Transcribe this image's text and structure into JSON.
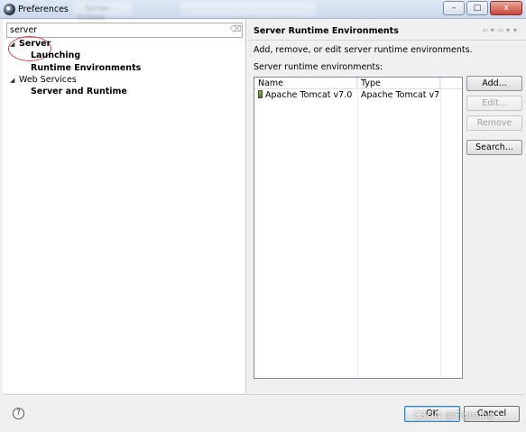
{
  "window": {
    "title": "Preferences",
    "blurred_tabs": [
      "...Server - Eclipse",
      "..."
    ]
  },
  "controls": {
    "minimize": "–",
    "maximize": "□",
    "close": "x"
  },
  "filter": {
    "value": "server",
    "clear_icon": "clear-filter-icon"
  },
  "tree": [
    {
      "label": "Server",
      "expanded": true,
      "level": 0,
      "bold": true
    },
    {
      "label": "Launching",
      "level": 1,
      "bold": true
    },
    {
      "label": "Runtime Environments",
      "level": 1,
      "bold": true,
      "selected": true
    },
    {
      "label": "Web Services",
      "expanded": true,
      "level": 0,
      "bold": false
    },
    {
      "label": "Server and Runtime",
      "level": 1,
      "bold": true
    }
  ],
  "page": {
    "title": "Server Runtime Environments",
    "description": "Add, remove, or edit server runtime environments.",
    "list_label": "Server runtime environments:",
    "columns": [
      "Name",
      "Type"
    ],
    "rows": [
      {
        "name": "Apache Tomcat v7.0",
        "type": "Apache Tomcat v7..."
      }
    ]
  },
  "buttons": {
    "add": "Add...",
    "edit": "Edit...",
    "remove": "Remove",
    "search": "Search...",
    "ok": "OK",
    "cancel": "Cancel"
  },
  "help": "?",
  "watermark": "CSDN @Fighting",
  "colors": {
    "highlight_circle": "#d64545",
    "titlebar": "#c9d8ea"
  }
}
